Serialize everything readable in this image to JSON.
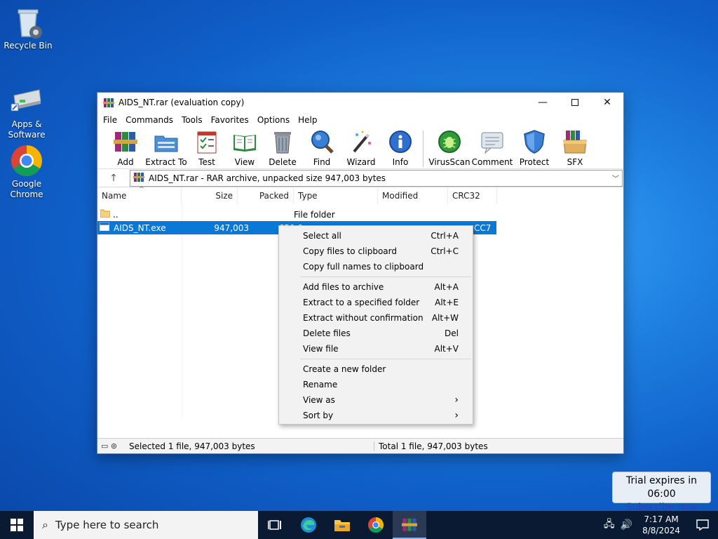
{
  "desktop": {
    "icons": [
      {
        "label": "Recycle Bin"
      },
      {
        "label": "Apps & Software"
      },
      {
        "label": "Google Chrome"
      }
    ]
  },
  "window": {
    "title": "AIDS_NT.rar (evaluation copy)",
    "menu": [
      "File",
      "Commands",
      "Tools",
      "Favorites",
      "Options",
      "Help"
    ],
    "toolbar": [
      "Add",
      "Extract To",
      "Test",
      "View",
      "Delete",
      "Find",
      "Wizard",
      "Info",
      "VirusScan",
      "Comment",
      "Protect",
      "SFX"
    ],
    "address": "AIDS_NT.rar - RAR archive, unpacked size 947,003 bytes",
    "columns": [
      "Name",
      "Size",
      "Packed",
      "Type",
      "Modified",
      "CRC32"
    ],
    "rows": [
      {
        "name": "..",
        "size": "",
        "packed": "",
        "type": "File folder",
        "modified": "",
        "crc": ""
      },
      {
        "name": "AIDS_NT.exe",
        "size": "947,003",
        "packed": "650,0",
        "type": "",
        "modified": "",
        "crc": "CC7"
      }
    ],
    "status_left": "Selected 1 file, 947,003 bytes",
    "status_right": "Total 1 file, 947,003 bytes"
  },
  "context_menu": {
    "groups": [
      [
        {
          "label": "Select all",
          "shortcut": "Ctrl+A"
        },
        {
          "label": "Copy files to clipboard",
          "shortcut": "Ctrl+C"
        },
        {
          "label": "Copy full names to clipboard",
          "shortcut": ""
        }
      ],
      [
        {
          "label": "Add files to archive",
          "shortcut": "Alt+A"
        },
        {
          "label": "Extract to a specified folder",
          "shortcut": "Alt+E"
        },
        {
          "label": "Extract without confirmation",
          "shortcut": "Alt+W"
        },
        {
          "label": "Delete files",
          "shortcut": "Del"
        },
        {
          "label": "View file",
          "shortcut": "Alt+V"
        }
      ],
      [
        {
          "label": "Create a new folder",
          "shortcut": ""
        },
        {
          "label": "Rename",
          "shortcut": ""
        },
        {
          "label": "View as",
          "shortcut": "›"
        },
        {
          "label": "Sort by",
          "shortcut": "›"
        }
      ]
    ]
  },
  "trial": {
    "text": "Trial expires in 06:00",
    "link": "Subscribe now"
  },
  "taskbar": {
    "search_placeholder": "Type here to search",
    "time": "7:17 AM",
    "date": "8/8/2024"
  }
}
